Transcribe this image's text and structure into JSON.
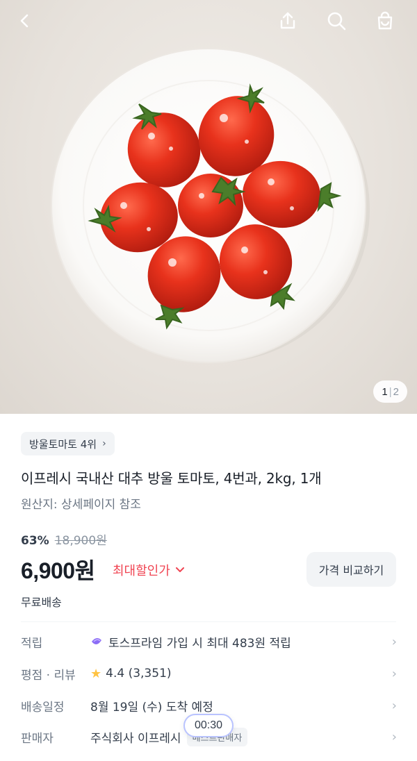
{
  "header": {
    "icons": [
      "back-icon",
      "share-icon",
      "search-icon",
      "shopping-bag-icon"
    ]
  },
  "gallery": {
    "current": "1",
    "total": "2"
  },
  "product": {
    "rank_chip": "방울토마토 4위",
    "title": "이프레시 국내산 대추 방울 토마토, 4번과, 2kg, 1개",
    "origin": "원산지: 상세페이지 참조",
    "discount_rate": "63%",
    "original_price": "18,900원",
    "price": "6,900원",
    "max_discount_label": "최대할인가",
    "compare_button": "가격 비교하기",
    "shipping": "무료배송"
  },
  "details": {
    "points": {
      "label": "적립",
      "value": "토스프라임 가입 시 최대 483원 적립"
    },
    "rating": {
      "label": "평점 · 리뷰",
      "value": "4.4 (3,351)"
    },
    "delivery": {
      "label": "배송일정",
      "value": "8월 19일 (수) 도착 예정"
    },
    "seller": {
      "label": "판매자",
      "value": "주식회사 이프레시",
      "badge": "베스트판매자"
    }
  },
  "timer": "00:30",
  "colors": {
    "accent_red": "#f04452",
    "star": "#ffc342",
    "text_primary": "#191f28",
    "text_secondary": "#6b7684"
  }
}
